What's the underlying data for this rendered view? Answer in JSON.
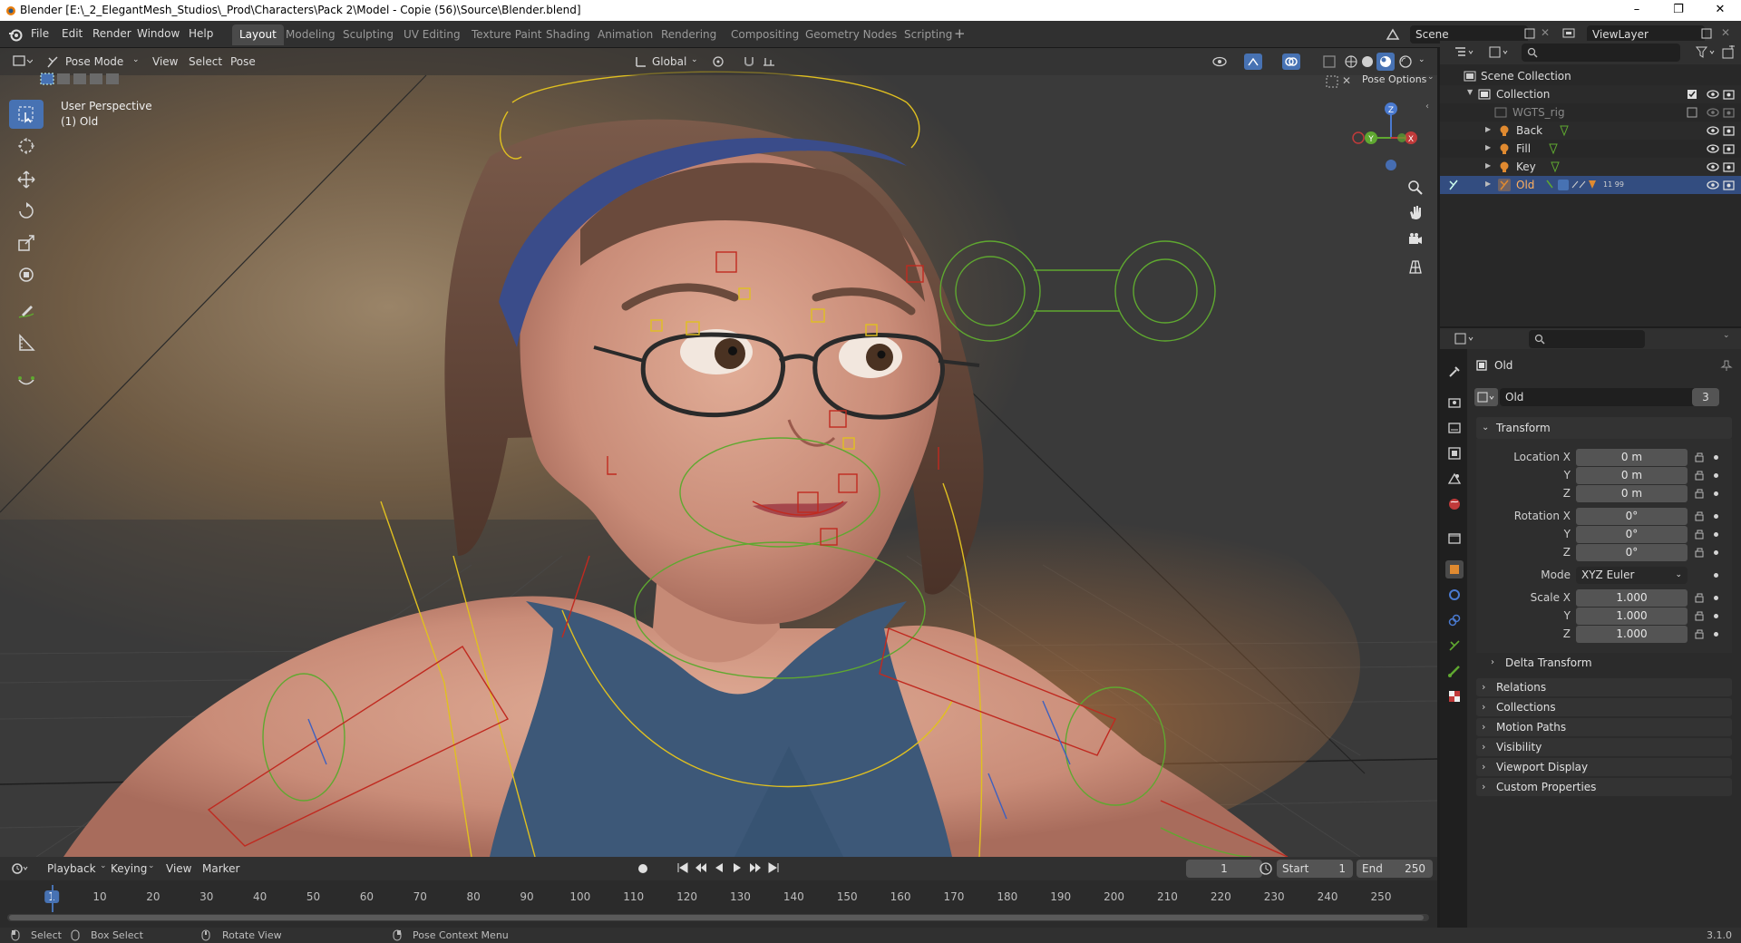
{
  "window": {
    "title": "Blender [E:\\_2_ElegantMesh_Studios\\_Prod\\Characters\\Pack 2\\Model - Copie (56)\\Source\\Blender.blend]"
  },
  "menu": {
    "file": "File",
    "edit": "Edit",
    "render": "Render",
    "window": "Window",
    "help": "Help"
  },
  "workspaces": [
    "Layout",
    "Modeling",
    "Sculpting",
    "UV Editing",
    "Texture Paint",
    "Shading",
    "Animation",
    "Rendering",
    "Compositing",
    "Geometry Nodes",
    "Scripting"
  ],
  "active_workspace": "Layout",
  "scene": {
    "label": "Scene",
    "viewlayer": "ViewLayer"
  },
  "viewport": {
    "mode": "Pose Mode",
    "menus": {
      "view": "View",
      "select": "Select",
      "pose": "Pose"
    },
    "orientation": "Global",
    "overlay_info_1": "User Perspective",
    "overlay_info_2": "(1) Old",
    "pose_options": "Pose Options",
    "gizmo": {
      "z": "Z",
      "y": "Y",
      "x": "X"
    }
  },
  "outliner": {
    "root": "Scene Collection",
    "items": [
      {
        "label": "Collection"
      },
      {
        "label": "WGTS_rig"
      },
      {
        "label": "Back"
      },
      {
        "label": "Fill"
      },
      {
        "label": "Key"
      },
      {
        "label": "Old",
        "badge": "11 99"
      }
    ]
  },
  "properties": {
    "object_name": "Old",
    "datablock_name": "Old",
    "datablock_users": "3",
    "transform_label": "Transform",
    "location": {
      "label": "Location X",
      "x": "0 m",
      "y": "0 m",
      "z": "0 m"
    },
    "rotation": {
      "label": "Rotation X",
      "x": "0°",
      "y": "0°",
      "z": "0°"
    },
    "mode_label": "Mode",
    "mode_value": "XYZ Euler",
    "scale": {
      "label": "Scale X",
      "x": "1.000",
      "y": "1.000",
      "z": "1.000"
    },
    "axis": {
      "y": "Y",
      "z": "Z"
    },
    "delta_transform": "Delta Transform",
    "panels": [
      "Relations",
      "Collections",
      "Motion Paths",
      "Visibility",
      "Viewport Display",
      "Custom Properties"
    ]
  },
  "timeline": {
    "menus": {
      "playback": "Playback",
      "keying": "Keying",
      "view": "View",
      "marker": "Marker"
    },
    "current_frame": "1",
    "start_label": "Start",
    "start": "1",
    "end_label": "End",
    "end": "250",
    "ruler": [
      "1",
      "10",
      "20",
      "30",
      "40",
      "50",
      "60",
      "70",
      "80",
      "90",
      "100",
      "110",
      "120",
      "130",
      "140",
      "150",
      "160",
      "170",
      "180",
      "190",
      "200",
      "210",
      "220",
      "230",
      "240",
      "250"
    ]
  },
  "statusbar": {
    "select": "Select",
    "box_select": "Box Select",
    "rotate_view": "Rotate View",
    "context_menu": "Pose Context Menu",
    "version": "3.1.0"
  },
  "colors": {
    "accent": "#4772b3",
    "selection": "#334d80",
    "bone_yellow": "#e0c020",
    "bone_red": "#c02a20",
    "bone_green": "#5fa830"
  }
}
